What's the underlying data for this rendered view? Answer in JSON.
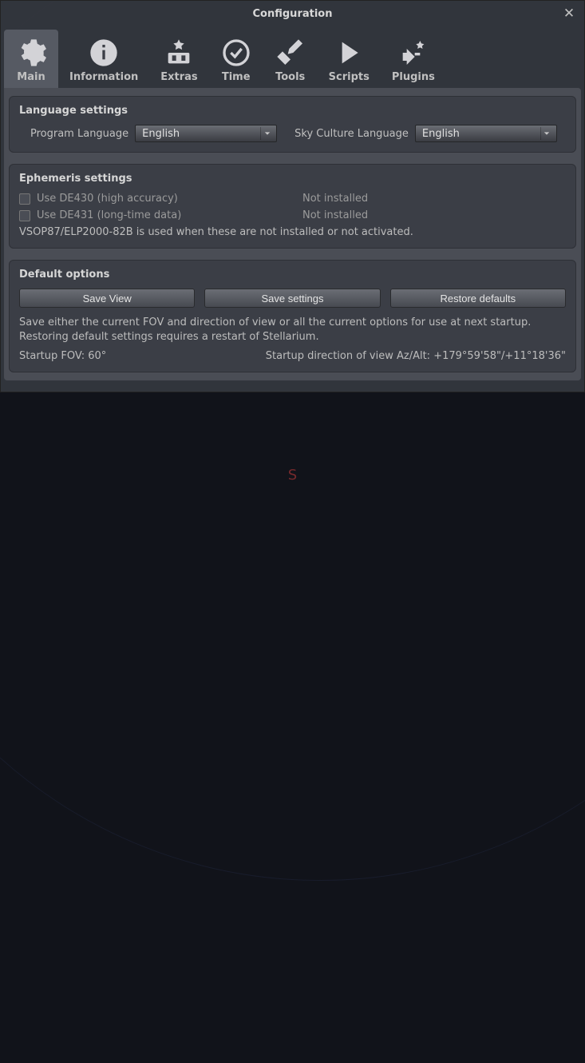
{
  "window": {
    "title": "Configuration"
  },
  "tabs": [
    {
      "label": "Main"
    },
    {
      "label": "Information"
    },
    {
      "label": "Extras"
    },
    {
      "label": "Time"
    },
    {
      "label": "Tools"
    },
    {
      "label": "Scripts"
    },
    {
      "label": "Plugins"
    }
  ],
  "language": {
    "heading": "Language settings",
    "program_label": "Program Language",
    "program_value": "English",
    "culture_label": "Sky Culture Language",
    "culture_value": "English"
  },
  "ephemeris": {
    "heading": "Ephemeris settings",
    "de430_label": "Use DE430 (high accuracy)",
    "de430_status": "Not installed",
    "de431_label": "Use DE431 (long-time data)",
    "de431_status": "Not installed",
    "note": "VSOP87/ELP2000-82B is used when these are not installed or not activated."
  },
  "defaults": {
    "heading": "Default options",
    "save_view": "Save View",
    "save_settings": "Save settings",
    "restore": "Restore defaults",
    "desc": "Save either the current FOV and direction of view or all the current options for use at next startup. Restoring default settings requires a restart of Stellarium.",
    "startup_fov": "Startup FOV: 60°",
    "startup_dir": "Startup direction of view Az/Alt: +179°59'58\"/+11°18'36\""
  },
  "compass": {
    "south": "S"
  }
}
